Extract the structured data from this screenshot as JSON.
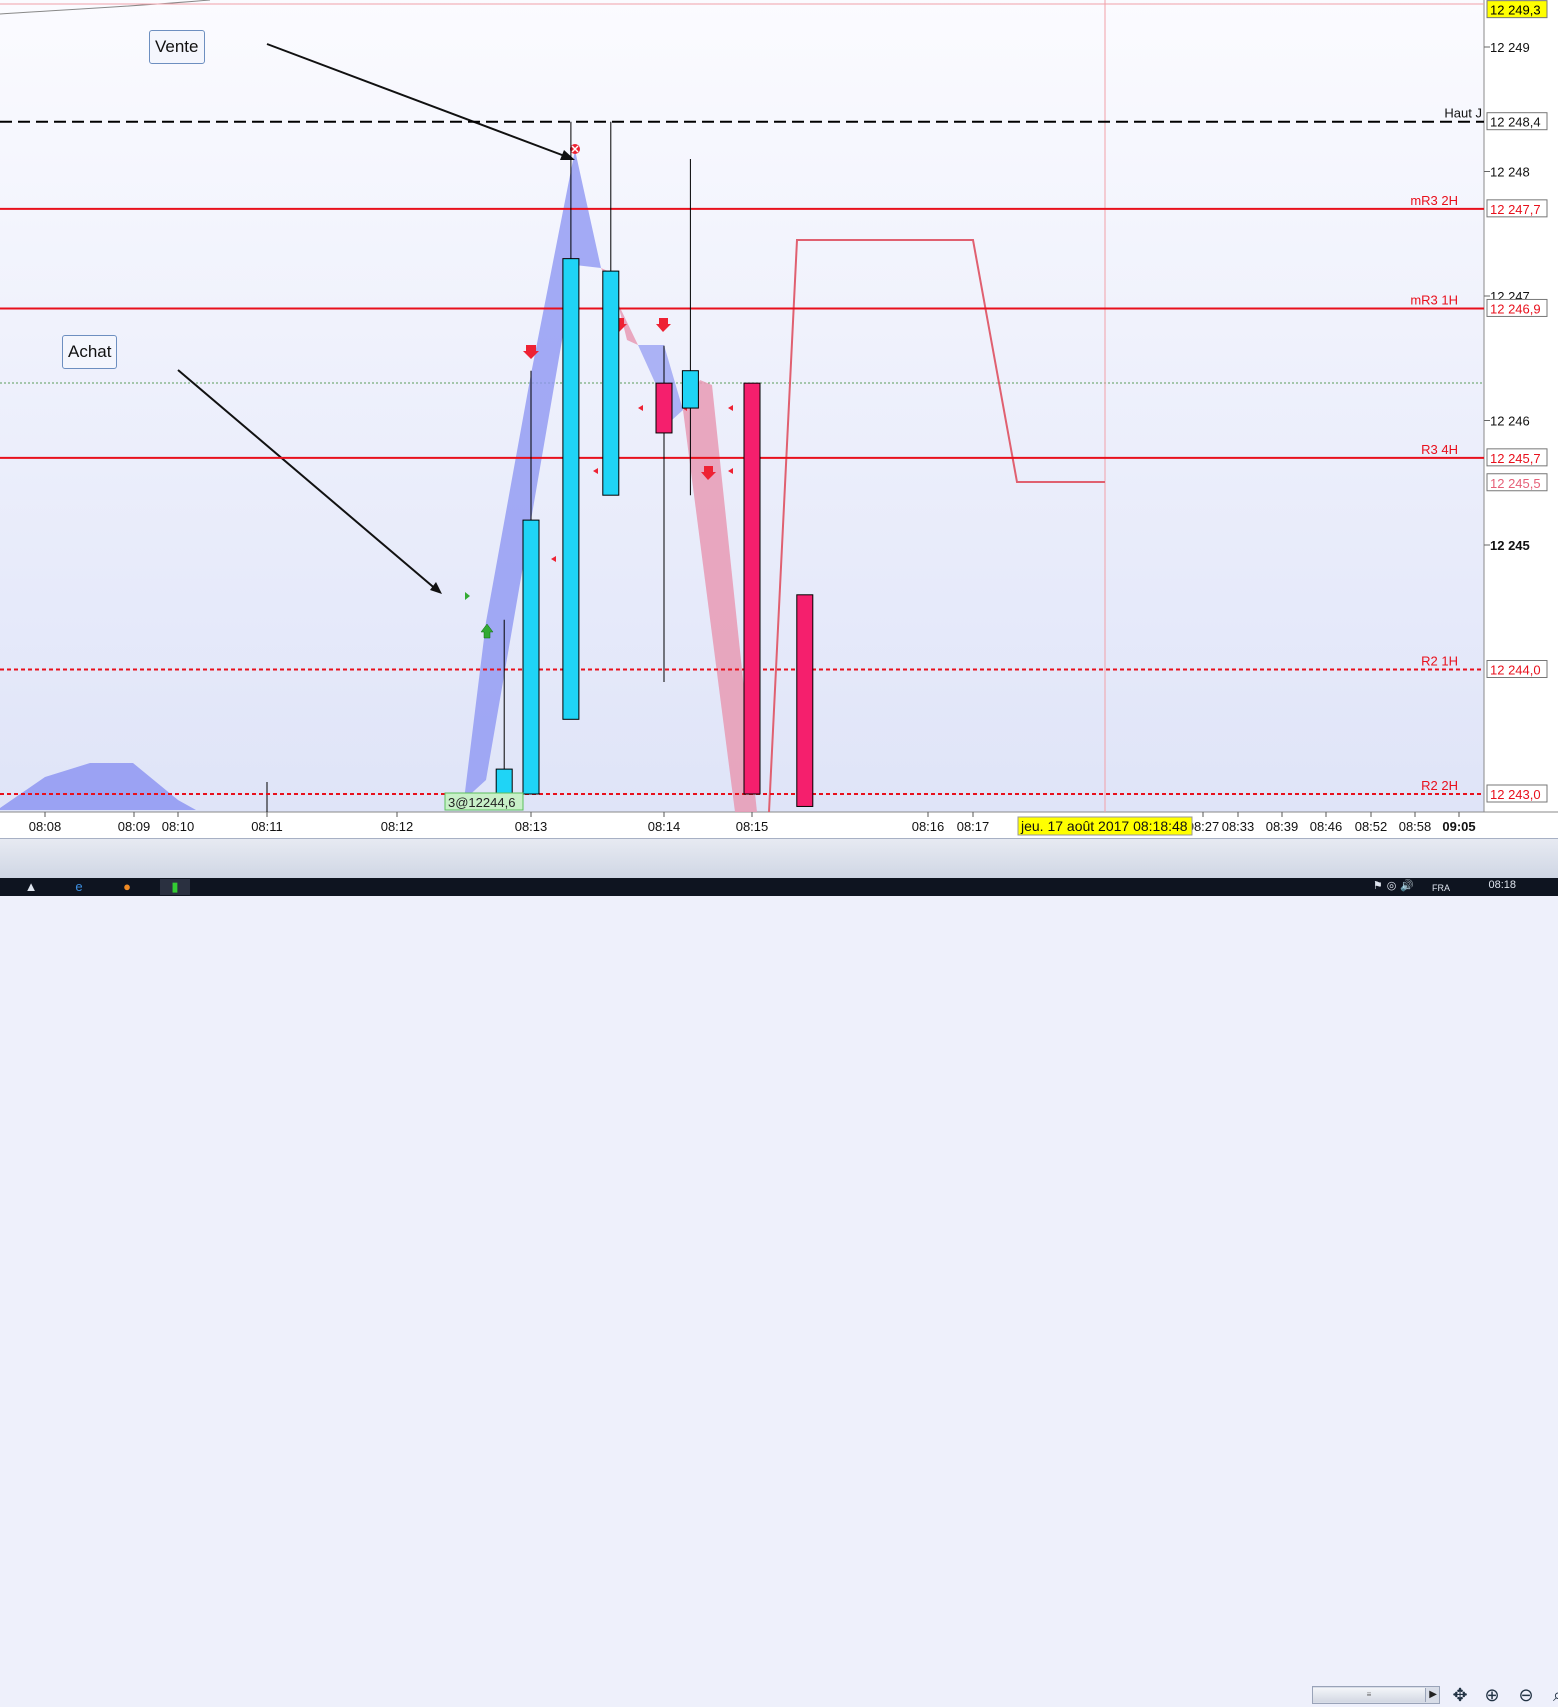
{
  "chart_data": {
    "type": "candlestick",
    "y_axis": {
      "ticks": [
        {
          "value": 12249,
          "label": "12 249"
        },
        {
          "value": 12248,
          "label": "12 248"
        },
        {
          "value": 12247,
          "label": "12 247"
        },
        {
          "value": 12246,
          "label": "12 246"
        },
        {
          "value": 12245,
          "label": "12 245",
          "bold": true
        },
        {
          "value": 12244,
          "label": ""
        }
      ],
      "range": [
        12242.9,
        12249.4
      ]
    },
    "x_axis": {
      "ticks": [
        "08:08",
        "08:09",
        "08:10",
        "08:11",
        "08:12",
        "08:13",
        "08:14",
        "08:15",
        "08:16",
        "08:17",
        "08:27",
        "08:33",
        "08:39",
        "08:46",
        "08:52",
        "08:58",
        "09:05"
      ],
      "current_time_label": "jeu. 17 août 2017 08:18:48"
    },
    "levels": [
      {
        "name": "Haut J",
        "value": 12248.4,
        "label": "12 248,4",
        "style": "dashed",
        "color": "#000000"
      },
      {
        "name": "mR3 2H",
        "value": 12247.7,
        "label": "12 247,7",
        "style": "solid",
        "color": "#e8101c"
      },
      {
        "name": "mR3 1H",
        "value": 12246.9,
        "label": "12 246,9",
        "style": "solid",
        "color": "#e8101c"
      },
      {
        "name": "R3 4H",
        "value": 12245.7,
        "label": "12 245,7",
        "style": "solid",
        "color": "#e8101c"
      },
      {
        "name": "R2 1H",
        "value": 12244.0,
        "label": "12 244,0",
        "style": "dotted",
        "color": "#e8101c"
      },
      {
        "name": "R2 2H",
        "value": 12243.0,
        "label": "12 243,0",
        "style": "dotted",
        "color": "#e8101c"
      }
    ],
    "price_tags": [
      {
        "value": 12249.3,
        "label": "12 249,3",
        "bg": "#ffff00",
        "color": "#000000"
      },
      {
        "value": 12245.5,
        "label": "12 245,5",
        "bg": "#ffffff",
        "color": "#e66078"
      }
    ],
    "candles": [
      {
        "time": "08:12.8",
        "open": 12243.0,
        "close": 12243.2,
        "high": 12244.4,
        "low": 12243.0,
        "dir": "up"
      },
      {
        "time": "08:13.0",
        "open": 12243.0,
        "close": 12245.2,
        "high": 12246.4,
        "low": 12243.0,
        "dir": "up"
      },
      {
        "time": "08:13.3",
        "open": 12243.6,
        "close": 12247.3,
        "high": 12248.4,
        "low": 12243.6,
        "dir": "up"
      },
      {
        "time": "08:13.6",
        "open": 12245.4,
        "close": 12247.2,
        "high": 12248.4,
        "low": 12245.4,
        "dir": "up"
      },
      {
        "time": "08:14.0",
        "open": 12246.3,
        "close": 12245.9,
        "high": 12246.6,
        "low": 12243.9,
        "dir": "down"
      },
      {
        "time": "08:14.3",
        "open": 12246.1,
        "close": 12246.4,
        "high": 12248.1,
        "low": 12245.4,
        "dir": "up"
      },
      {
        "time": "08:15.0",
        "open": 12246.3,
        "close": 12243.0,
        "high": 12246.3,
        "low": 12243.0,
        "dir": "down"
      },
      {
        "time": "08:15.3",
        "open": 12244.6,
        "close": 12242.9,
        "high": 12244.6,
        "low": 12242.9,
        "dir": "down"
      }
    ],
    "annotations": {
      "vente": "Vente",
      "achat": "Achat",
      "order_tag": "3@12244,6"
    }
  },
  "statusbar": {
    "scroll_icon": "scroll-thumb",
    "tools": [
      "pan-icon",
      "zoom-in-icon",
      "zoom-out-icon",
      "search-icon"
    ]
  },
  "taskbar": {
    "lang": "FRA",
    "clock": "08:18"
  }
}
